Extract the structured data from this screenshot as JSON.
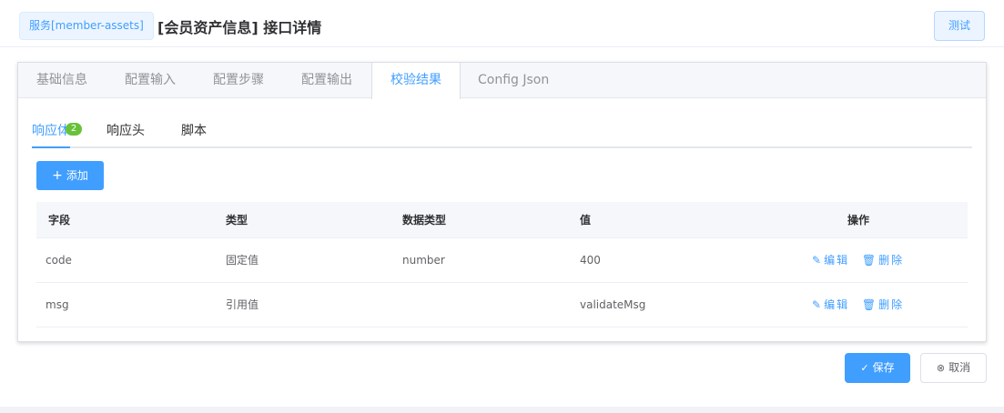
{
  "header": {
    "service_tag": "服务[member-assets]",
    "title": "[会员资产信息] 接口详情",
    "test_button": "测试"
  },
  "tabs": [
    {
      "label": "基础信息"
    },
    {
      "label": "配置输入"
    },
    {
      "label": "配置步骤"
    },
    {
      "label": "配置输出"
    },
    {
      "label": "校验结果",
      "active": true
    },
    {
      "label": "Config Json"
    }
  ],
  "subtabs": [
    {
      "label": "响应体",
      "badge": "2",
      "active": true
    },
    {
      "label": "响应头"
    },
    {
      "label": "脚本"
    }
  ],
  "add_button": "添加",
  "table": {
    "columns": [
      "字段",
      "类型",
      "数据类型",
      "值",
      "操作"
    ],
    "rows": [
      {
        "field": "code",
        "type": "固定值",
        "data_type": "number",
        "value": "400"
      },
      {
        "field": "msg",
        "type": "引用值",
        "data_type": "",
        "value": "validateMsg"
      }
    ],
    "edit_label": "编辑",
    "delete_label": "删除"
  },
  "footer": {
    "save_button": "保存",
    "cancel_button": "取消"
  },
  "colors": {
    "primary": "#409eff",
    "badge": "#67c23a",
    "header_bg": "#f5f7fa"
  },
  "icons": {
    "add": "plus-icon",
    "edit": "edit-icon",
    "delete": "trash-icon",
    "save": "check-circle-icon",
    "cancel": "close-circle-icon"
  }
}
